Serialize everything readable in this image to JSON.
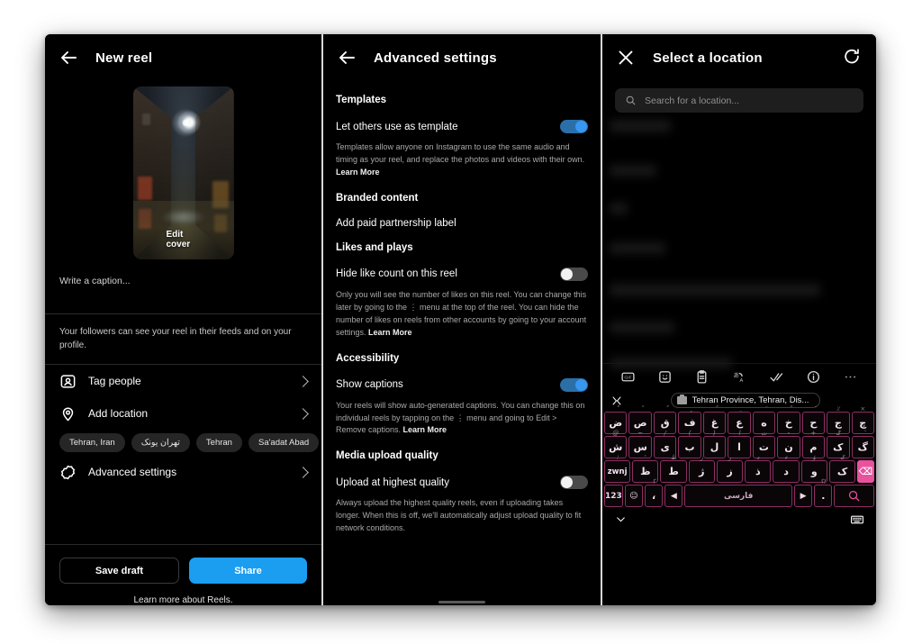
{
  "panel_new_reel": {
    "header": {
      "back_icon": "back-arrow-icon",
      "title": "New reel"
    },
    "cover": {
      "edit_label": "Edit cover"
    },
    "caption_placeholder": "Write a caption...",
    "audience_note": "Your followers can see your reel in their feeds and on your profile.",
    "rows": [
      {
        "icon": "tag-people-icon",
        "label": "Tag people"
      },
      {
        "icon": "location-pin-icon",
        "label": "Add location"
      }
    ],
    "location_chips": [
      "Tehran, Iran",
      "تهران یونک",
      "Tehran",
      "Sa'adat Abad"
    ],
    "advanced_row": {
      "icon": "gear-icon",
      "label": "Advanced settings"
    },
    "buttons": {
      "save_draft": "Save draft",
      "share": "Share"
    },
    "footer_link": "Learn more about Reels.",
    "share_color": "#1b9df0"
  },
  "panel_advanced": {
    "header": {
      "back_icon": "back-arrow-icon",
      "title": "Advanced settings"
    },
    "sections": [
      {
        "title": "Templates",
        "toggle_label": "Let others use as template",
        "toggle_state": "on",
        "description": "Templates allow anyone on Instagram to use the same audio and timing as your reel, and replace the photos and videos with their own. ",
        "description_link": "Learn More"
      },
      {
        "title": "Branded content",
        "plain_row": "Add paid partnership label"
      },
      {
        "title": "Likes and plays",
        "toggle_label": "Hide like count on this reel",
        "toggle_state": "off",
        "description": "Only you will see the number of likes on this reel. You can change this later by going to the ⋮ menu at the top of the reel. You can hide the number of likes on reels from other accounts by going to your account settings. ",
        "description_link": "Learn More"
      },
      {
        "title": "Accessibility",
        "toggle_label": "Show captions",
        "toggle_state": "on",
        "description": "Your reels will show auto-generated captions. You can change this on individual reels by tapping on the ⋮ menu and going to Edit > Remove captions. ",
        "description_link": "Learn More"
      },
      {
        "title": "Media upload quality",
        "toggle_label": "Upload at highest quality",
        "toggle_state": "off",
        "description": "Always upload the highest quality reels, even if uploading takes longer. When this is off, we'll automatically adjust upload quality to fit network conditions.",
        "description_link": ""
      }
    ],
    "toggle_on_color": "#3897f0"
  },
  "panel_location": {
    "header": {
      "close_icon": "close-x-icon",
      "title": "Select a location",
      "refresh_icon": "refresh-icon"
    },
    "search": {
      "icon": "search-icon",
      "placeholder": "Search for a location...",
      "value": ""
    },
    "keyboard_toolbar": [
      "gif-icon",
      "sticker-icon",
      "clipboard-icon",
      "translate-icon",
      "checkmark-icon",
      "info-icon",
      "more-options-icon"
    ],
    "suggestion": {
      "collapse_icon": "collapse-icon",
      "icon": "briefcase-icon",
      "text": "Tehran Province, Tehran, Dis..."
    },
    "keyboard": {
      "accent_color": "#e8539e",
      "row1": [
        {
          "main": "ض",
          "sup": "ْ"
        },
        {
          "main": "ص",
          "sup": "ً"
        },
        {
          "main": "ق",
          "sup": "ٌ"
        },
        {
          "main": "ف",
          "sup": "ٍ"
        },
        {
          "main": "غ",
          "sup": "ُ"
        },
        {
          "main": "ع",
          "sup": "ِ"
        },
        {
          "main": "ه",
          "sup": "َ"
        },
        {
          "main": "خ",
          "sup": "ّ"
        },
        {
          "main": "ح",
          "sup": "ٓ"
        },
        {
          "main": "ج",
          "sup": "٪"
        },
        {
          "main": "چ",
          "sup": "×"
        }
      ],
      "row2": [
        {
          "main": "ش",
          "sup": "@"
        },
        {
          "main": "س",
          "sup": "~"
        },
        {
          "main": "ی",
          "sup": "/"
        },
        {
          "main": "ب",
          "sup": "("
        },
        {
          "main": "ل",
          "sup": ")"
        },
        {
          "main": "ا",
          "sup": "ا"
        },
        {
          "main": "ت",
          "sup": "ت"
        },
        {
          "main": "ن",
          "sup": "-"
        },
        {
          "main": "م",
          "sup": "+"
        },
        {
          "main": "ک",
          "sup": "ݣ"
        },
        {
          "main": "گ",
          "sup": "ٔ"
        }
      ],
      "row3": [
        {
          "main": "zwnj",
          "sup": "؛"
        },
        {
          "main": "ظ",
          "sup": "'"
        },
        {
          "main": "ط",
          "sup": "ظ"
        },
        {
          "main": "ژ",
          "sup": "ز"
        },
        {
          "main": "ز",
          "sup": "ر"
        },
        {
          "main": "ذ",
          "sup": "د"
        },
        {
          "main": "د",
          "sup": "ء"
        },
        {
          "main": "و",
          "sup": "ؤ"
        },
        {
          "main": "ک",
          "sup": "ݢ"
        },
        {
          "main": "⌫",
          "sup": ""
        }
      ],
      "row4": [
        {
          "main": "123",
          "sup": ""
        },
        {
          "main": "☺",
          "sup": ""
        },
        {
          "main": "،",
          "sup": "؟"
        },
        {
          "main": "◀",
          "sup": ""
        },
        {
          "main": "فارسی",
          "sup": ""
        },
        {
          "main": "▶",
          "sup": ""
        },
        {
          "main": ".",
          "sup": "؟!"
        },
        {
          "main": "search",
          "sup": ""
        }
      ]
    },
    "bottom_bar": {
      "collapse_icon": "chevron-down-icon",
      "keyboard_icon": "keyboard-switch-icon"
    }
  }
}
